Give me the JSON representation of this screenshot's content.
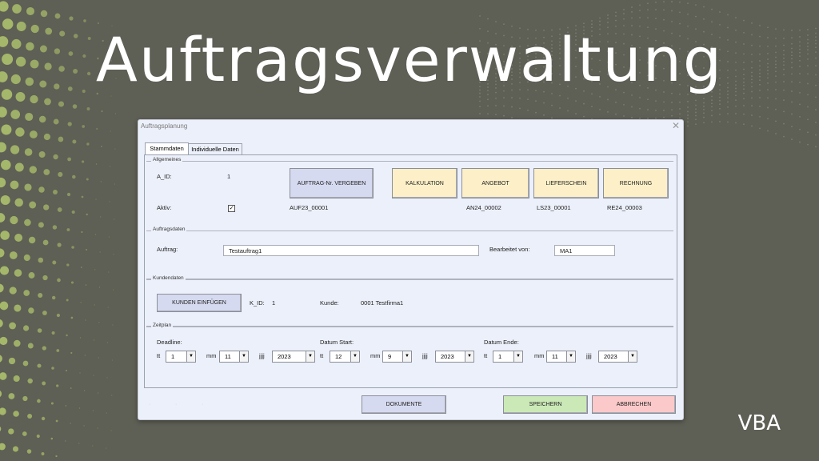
{
  "slide": {
    "title": "Auftragsverwaltung",
    "tag": "VBA"
  },
  "colors": {
    "background": "#5e5f55",
    "dots": "#a5b76a",
    "dialog": "#ecf0fa"
  },
  "dialog": {
    "title": "Auftragsplanung",
    "close_icon": "close-icon",
    "tabs": [
      {
        "label": "Stammdaten",
        "active": true
      },
      {
        "label": "Individuelle Daten",
        "active": false
      }
    ],
    "allgemeines": {
      "label": "Allgemeines",
      "a_id_label": "A_ID:",
      "a_id_value": "1",
      "aktiv_label": "Aktiv:",
      "aktiv_checked": true,
      "check_mark": "✓",
      "auftrag_nr_button": "AUFTRAG-Nr. VERGEBEN",
      "auftrag_nr_value": "AUF23_00001",
      "buttons": [
        "KALKULATION",
        "ANGEBOT",
        "LIEFERSCHEIN",
        "RECHNUNG"
      ],
      "angebot_value": "AN24_00002",
      "lieferschein_value": "LS23_00001",
      "rechnung_value": "RE24_00003"
    },
    "auftragsdaten": {
      "label": "Auftragsdaten",
      "auftrag_label": "Auftrag:",
      "auftrag_value": "Testauftrag1",
      "bearbeitet_label": "Bearbeitet von:",
      "bearbeitet_value": "MA1"
    },
    "kundendaten": {
      "label": "Kundendaten",
      "einfuegen_button": "KUNDEN EINFÜGEN",
      "k_id_label": "K_ID:",
      "k_id_value": "1",
      "kunde_label": "Kunde:",
      "kunde_value": "0001 Testfirma1"
    },
    "zeitplan": {
      "label": "Zeitplan",
      "deadline_label": "Deadline:",
      "start_label": "Datum Start:",
      "ende_label": "Datum Ende:",
      "tt": "tt",
      "mm": "mm",
      "jjjj": "jjjj",
      "deadline": {
        "tt": "1",
        "mm": "11",
        "jjjj": "2023"
      },
      "start": {
        "tt": "12",
        "mm": "9",
        "jjjj": "2023"
      },
      "ende": {
        "tt": "1",
        "mm": "11",
        "jjjj": "2023"
      },
      "arrow": "▼"
    },
    "footer": {
      "nav_dots": [
        "·",
        "·",
        "·"
      ],
      "dokumente": "DOKUMENTE",
      "speichern": "SPEICHERN",
      "abbrechen": "ABBRECHEN"
    }
  }
}
